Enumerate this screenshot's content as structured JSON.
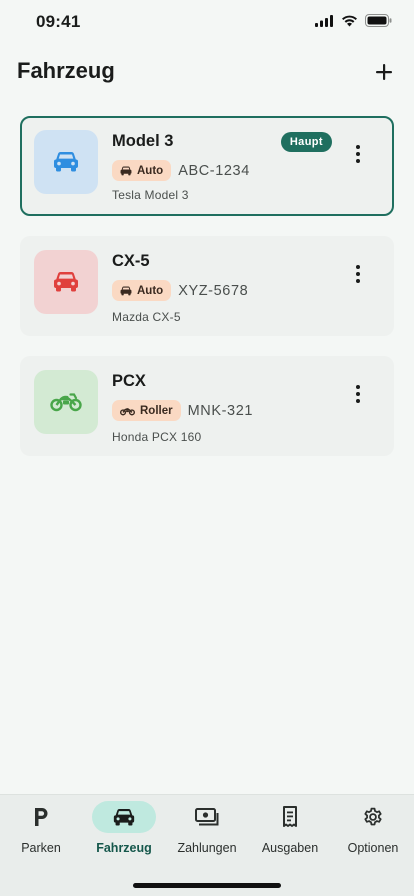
{
  "status_bar": {
    "time": "09:41"
  },
  "header": {
    "title": "Fahrzeug",
    "add_icon": "plus-icon"
  },
  "colors": {
    "accent": "#1f6f5f",
    "chip_bg": "#fad9c3",
    "car_blue": "#2f8ee0",
    "car_red": "#e0403d",
    "moto_green": "#49a64a"
  },
  "vehicles": [
    {
      "name": "Model 3",
      "type_label": "Auto",
      "type_icon": "car-icon",
      "plate": "ABC-1234",
      "model": "Tesla Model 3",
      "badge": "Haupt",
      "primary": true
    },
    {
      "name": "CX-5",
      "type_label": "Auto",
      "type_icon": "car-icon",
      "plate": "XYZ-5678",
      "model": "Mazda CX-5",
      "primary": false
    },
    {
      "name": "PCX",
      "type_label": "Roller",
      "type_icon": "motorcycle-icon",
      "plate": "MNK-321",
      "model": "Honda PCX 160",
      "primary": false
    }
  ],
  "tabs": [
    {
      "label": "Parken",
      "icon": "parking-icon",
      "active": false
    },
    {
      "label": "Fahrzeug",
      "icon": "car-icon",
      "active": true
    },
    {
      "label": "Zahlungen",
      "icon": "payments-icon",
      "active": false
    },
    {
      "label": "Ausgaben",
      "icon": "receipt-icon",
      "active": false
    },
    {
      "label": "Optionen",
      "icon": "gear-icon",
      "active": false
    }
  ]
}
